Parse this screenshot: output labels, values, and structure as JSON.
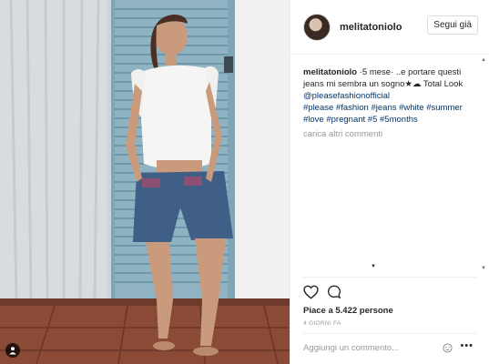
{
  "post": {
    "username": "melitatoniolo",
    "follow_label": "Segui già",
    "caption_user": "melitatoniolo",
    "caption_text_1": " ·5 mese· ..e portare questi jeans mi sembra un sogno★☁ Total Look ",
    "mention": "@pleasefashionofficial",
    "hashtags": [
      "#please",
      "#fashion",
      "#jeans",
      "#white",
      "#summer",
      "#love",
      "#pregnant",
      "#5",
      "#5months"
    ],
    "load_more": "carica altri commenti",
    "likes": "Piace a 5.422 persone",
    "time_ago": "4 GIORNI FA",
    "comment_placeholder": "Aggiungi un commento...",
    "more_label": "•••"
  },
  "icons": {
    "like": "heart-outline-icon",
    "comment": "speech-bubble-icon",
    "user_tag": "person-icon",
    "emoji": "smiley-icon"
  },
  "colors": {
    "link": "#003569",
    "text": "#262626",
    "muted": "#999999",
    "border": "#efefef"
  }
}
